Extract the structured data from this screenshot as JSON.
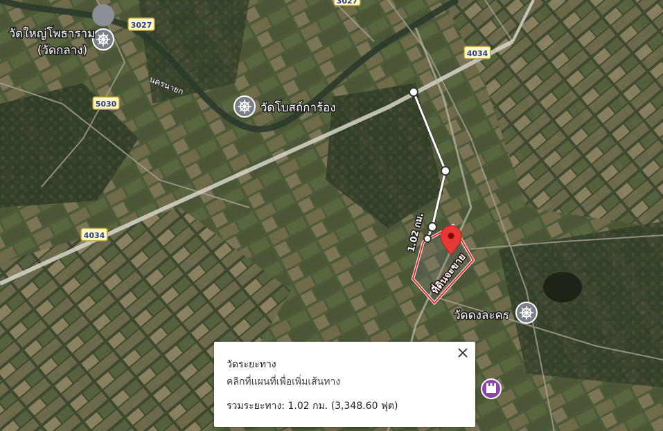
{
  "map": {
    "view": "satellite",
    "places": [
      {
        "name_line1": "วัดใหญ่โพธาราม",
        "name_line2": "(วัดกลาง)",
        "icon": "temple-icon"
      },
      {
        "name_line1": "วัดโบสถ์การ้อง",
        "icon": "temple-icon"
      },
      {
        "name_line1": "วัดดงละคร",
        "icon": "temple-icon"
      }
    ],
    "road_shields": [
      "3027",
      "3027",
      "4034",
      "5030",
      "4034"
    ],
    "road_labels": [
      "นครนายก"
    ],
    "measure_distance_label": "1.02 กม.",
    "parcel_label": "ที่ดินจะขาย",
    "colors": {
      "measure_line": "#ffffff",
      "parcel_outline": "#e8202a",
      "pin": "#e53935",
      "poi_purple": "#8e44ad"
    }
  },
  "panel": {
    "title": "วัดระยะทาง",
    "hint": "คลิกที่แผนที่เพื่อเพิ่มเส้นทาง",
    "total": "รวมระยะทาง: 1.02 กม. (3,348.60 ฟุต)",
    "close_icon": "close-icon"
  }
}
